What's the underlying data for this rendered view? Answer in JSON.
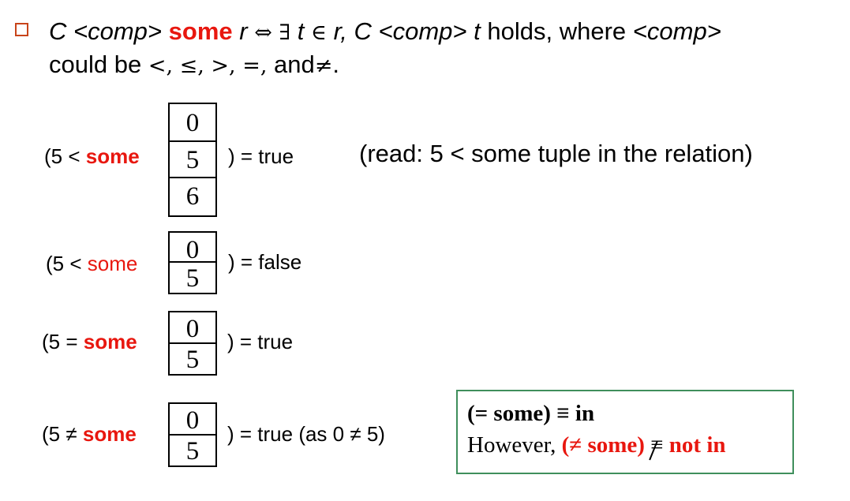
{
  "header": {
    "c": "C",
    "comp1": "<comp>",
    "some": "some",
    "r1": "r",
    "iff": "⇔",
    "exists": "∃",
    "t1": "t",
    "elem": "∈",
    "r2": "r,",
    "c2": "C",
    "comp2": "<comp>",
    "t2": "t",
    "holds": "holds, where",
    "comp3": "<comp>",
    "could_be": "could be",
    "ops": "<, ≤, >, =,",
    "and": "and",
    "neq": "≠",
    "period": "."
  },
  "rows": [
    {
      "prefix": "(5 <",
      "label": "some",
      "values": [
        "0",
        "5",
        "6"
      ],
      "result": ") = true",
      "note": "(read:  5 < some tuple in the relation)"
    },
    {
      "prefix": "(5 <",
      "label": "some",
      "values": [
        "0",
        "5"
      ],
      "result": ") = false"
    },
    {
      "prefix": "(5 =",
      "label": "some",
      "values": [
        "0",
        "5"
      ],
      "result": ") = true"
    },
    {
      "prefix": "(5 ≠",
      "label": "some",
      "values": [
        "0",
        "5"
      ],
      "result": ") = true (as 0 ≠ 5)"
    }
  ],
  "infobox": {
    "line1": "(= some) ≡ in",
    "however": "However,",
    "neq_some": "(≠ some)",
    "equiv": "≡",
    "not_in": "not in"
  },
  "colors": {
    "accent_red": "#e8170f",
    "bullet": "#c8441a",
    "box_border": "#3f8f5c"
  }
}
